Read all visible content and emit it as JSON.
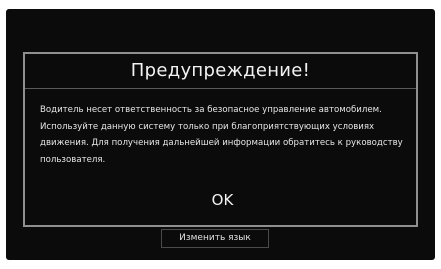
{
  "dialog": {
    "title": "Предупреждение!",
    "message": "Водитель несет ответственность за безопасное управление автомобилем. Используйте данную систему только при благоприятствующих условиях движения. Для получения дальнейшей информации обратитесь к руководству пользователя.",
    "ok_label": "OK"
  },
  "footer": {
    "change_language_label": "Изменить язык"
  },
  "colors": {
    "screen_background": "#0b0b0b",
    "dialog_border": "#8f8f8f",
    "text": "#f2f2f2"
  }
}
